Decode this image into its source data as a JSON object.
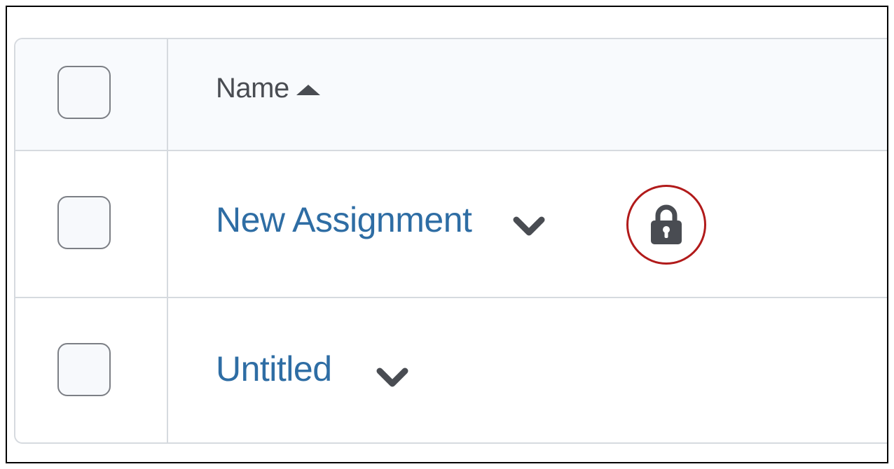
{
  "table": {
    "header": {
      "name_label": "Name",
      "sort_icon": "triangle-up-icon"
    },
    "rows": [
      {
        "name": "New Assignment",
        "menu_icon": "chevron-down-icon",
        "status_icon": "lock-icon",
        "highlight_color": "#b11a1a"
      },
      {
        "name": "Untitled",
        "menu_icon": "chevron-down-icon"
      }
    ]
  },
  "colors": {
    "link": "#2e6da4",
    "header_bg": "#f8fafd",
    "border": "#d6dadf",
    "icon": "#494c52"
  }
}
